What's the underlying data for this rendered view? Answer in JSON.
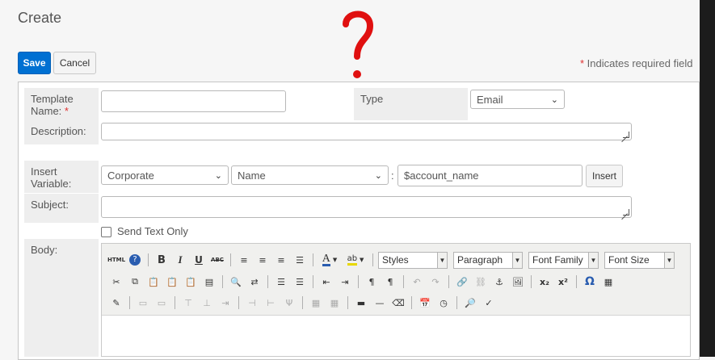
{
  "page": {
    "title": "Create"
  },
  "actions": {
    "save_label": "Save",
    "cancel_label": "Cancel"
  },
  "required_note": {
    "star": "*",
    "text": " Indicates required field"
  },
  "annotation": {
    "symbol": "?",
    "color": "#e01010"
  },
  "form": {
    "template_name": {
      "label": "Template Name:",
      "required_star": "*",
      "value": ""
    },
    "type": {
      "label": "Type",
      "value": "Email"
    },
    "description": {
      "label": "Description:",
      "value": ""
    },
    "insert_variable": {
      "label": "Insert Variable:",
      "category": "Corporate",
      "field": "Name",
      "colon": ":",
      "value": "$account_name",
      "insert_label": "Insert"
    },
    "subject": {
      "label": "Subject:",
      "value": ""
    },
    "send_text_only": {
      "label": "Send Text Only",
      "checked": false
    },
    "body": {
      "label": "Body:"
    }
  },
  "editor": {
    "row1": {
      "html_label": "HTML",
      "bold": "B",
      "italic": "I",
      "underline": "U",
      "strike": "ABC",
      "font_color": "A",
      "highlight": "ab",
      "styles": "Styles",
      "paragraph": "Paragraph",
      "font_family": "Font Family",
      "font_size": "Font Size"
    },
    "row2": {
      "subscript": "x₂",
      "superscript": "x²",
      "omega": "Ω"
    }
  },
  "colors": {
    "accent": "#0070d2",
    "label_bg": "#eeeeee",
    "required": "#e03030"
  }
}
